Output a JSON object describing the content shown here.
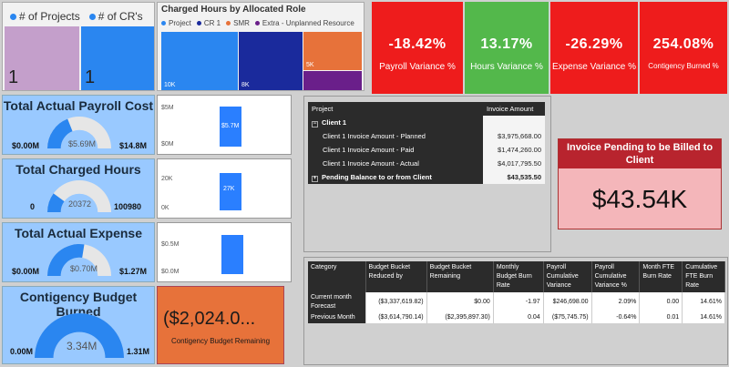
{
  "projects_card": {
    "legend": [
      "# of Projects",
      "# of CR's"
    ],
    "projects_value": "1",
    "crs_value": "1",
    "colors": {
      "projects": "#c49fcb",
      "crs": "#2a86f0"
    }
  },
  "treemap": {
    "title": "Charged Hours by Allocated Role",
    "legend": [
      "Project",
      "CR 1",
      "SMR",
      "Extra - Unplanned Resource"
    ],
    "legend_colors": [
      "#2a86f0",
      "#1a2a9c",
      "#e7723a",
      "#6a1f8a"
    ],
    "values": [
      "10K",
      "8K",
      "5K"
    ]
  },
  "kpis": [
    {
      "value": "-18.42%",
      "label": "Payroll Variance %",
      "color": "#ee1c1c"
    },
    {
      "value": "13.17%",
      "label": "Hours Variance %",
      "color": "#53b84b"
    },
    {
      "value": "-26.29%",
      "label": "Expense Variance %",
      "color": "#ee1c1c"
    },
    {
      "value": "254.08%",
      "label": "Contigency Burned %",
      "color": "#ee1c1c"
    }
  ],
  "gauges": {
    "payroll": {
      "title": "Total Actual Payroll Cost",
      "min": "$0.00M",
      "max": "$14.8M",
      "value": "$5.69M",
      "fraction": 0.38
    },
    "hours": {
      "title": "Total Charged Hours",
      "min": "0",
      "max": "100980",
      "value": "20372",
      "fraction": 0.2
    },
    "expense": {
      "title": "Total Actual Expense",
      "min": "$0.00M",
      "max": "$1.27M",
      "value": "$0.70M",
      "fraction": 0.55
    },
    "contingency": {
      "title": "Contigency Budget Burned",
      "min": "0.00M",
      "max": "1.31M",
      "value": "3.34M",
      "fraction": 1.0
    }
  },
  "mini_charts": {
    "payroll": {
      "ticks": [
        "$5M",
        "$0M"
      ],
      "bar_label": "$5.7M",
      "bar_value": 5.7,
      "max": 6
    },
    "hours": {
      "ticks": [
        "20K",
        "0K"
      ],
      "bar_label": "27K",
      "bar_value": 27,
      "max": 30
    },
    "expense": {
      "ticks": [
        "$0.5M",
        "$0.0M"
      ],
      "bar_label": "",
      "bar_value": 0.7,
      "max": 0.75
    }
  },
  "invoice_table": {
    "headers": [
      "Project",
      "Invoice Amount"
    ],
    "group": "Client 1",
    "rows": [
      {
        "label": "Client 1 Invoice Amount - Planned",
        "value": "$3,975,668.00"
      },
      {
        "label": "Client 1 Invoice Amount - Paid",
        "value": "$1,474,260.00"
      },
      {
        "label": "Client 1 Invoice Amount - Actual",
        "value": "$4,017,795.50"
      }
    ],
    "total_label": "Pending Balance to or from Client",
    "total_value": "$43,535.50"
  },
  "pending": {
    "title": "Invoice Pending to be Billed to Client",
    "value": "$43.54K"
  },
  "budget_table": {
    "headers": [
      "Category",
      "Budget Bucket Reduced by",
      "Budget Bucket Remaining",
      "Monthly Budget Burn Rate",
      "Payroll Cumulative Variance",
      "Payroll Cumulative Variance %",
      "Month FTE Burn Rate",
      "Cumulative FTE Burn Rate"
    ],
    "rows": [
      [
        "Current month Forecast",
        "($3,337,619.82)",
        "$0.00",
        "-1.97",
        "$246,698.00",
        "2.09%",
        "0.00",
        "14.61%"
      ],
      [
        "Previous Month",
        "($3,614,790.14)",
        "($2,395,897.30)",
        "0.04",
        "($75,745.75)",
        "-0.64%",
        "0.01",
        "14.61%"
      ]
    ]
  },
  "remaining": {
    "value": "($2,024.0...",
    "label": "Contigency Budget Remaining"
  }
}
